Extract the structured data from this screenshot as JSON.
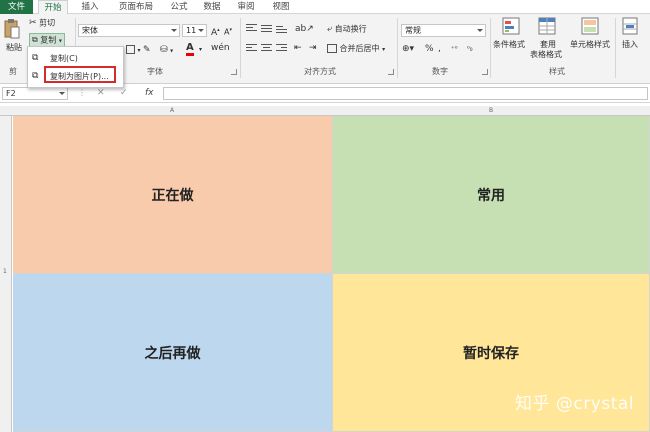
{
  "tabs": [
    {
      "label": "文件",
      "kind": "file"
    },
    {
      "label": "开始",
      "kind": "active"
    },
    {
      "label": "插入",
      "kind": "normal"
    },
    {
      "label": "页面布局",
      "kind": "normal"
    },
    {
      "label": "公式",
      "kind": "normal"
    },
    {
      "label": "数据",
      "kind": "normal"
    },
    {
      "label": "审阅",
      "kind": "normal"
    },
    {
      "label": "视图",
      "kind": "normal"
    }
  ],
  "clipboard": {
    "paste_label": "粘贴",
    "cut_label": "剪切",
    "copy_label": "复制",
    "group_label": "剪"
  },
  "font": {
    "font_name": "宋体",
    "font_size": "11",
    "bold": "B",
    "italic": "I",
    "underline": "U",
    "group_label": "字体"
  },
  "alignment": {
    "wrap_text": "自动换行",
    "merge_center": "合并后居中",
    "group_label": "对齐方式"
  },
  "number": {
    "format": "常规",
    "group_label": "数字"
  },
  "styles": {
    "conditional": "条件格式",
    "table_line1": "套用",
    "table_line2": "表格格式",
    "cell_styles": "单元格样式",
    "group_label": "样式"
  },
  "cells_group": {
    "insert": "插入"
  },
  "copy_menu": {
    "item_copy": "复制(C)",
    "item_copy_as_picture": "复制为图片(P)..."
  },
  "formula_bar": {
    "name_box": "F2",
    "fx": "fx",
    "formula": ""
  },
  "grid": {
    "col_a": "A",
    "col_b": "B",
    "row_1": "1",
    "cells": [
      {
        "text": "正在做",
        "color": "#f8cbad"
      },
      {
        "text": "常用",
        "color": "#c6e0b4"
      },
      {
        "text": "之后再做",
        "color": "#bdd7ee"
      },
      {
        "text": "暂时保存",
        "color": "#ffe699"
      }
    ]
  },
  "watermark": "知乎 @crystal",
  "colors": {
    "excel_green": "#217346",
    "highlight_red": "#d42b2b",
    "ribbon_bg": "#f3f3f3"
  }
}
